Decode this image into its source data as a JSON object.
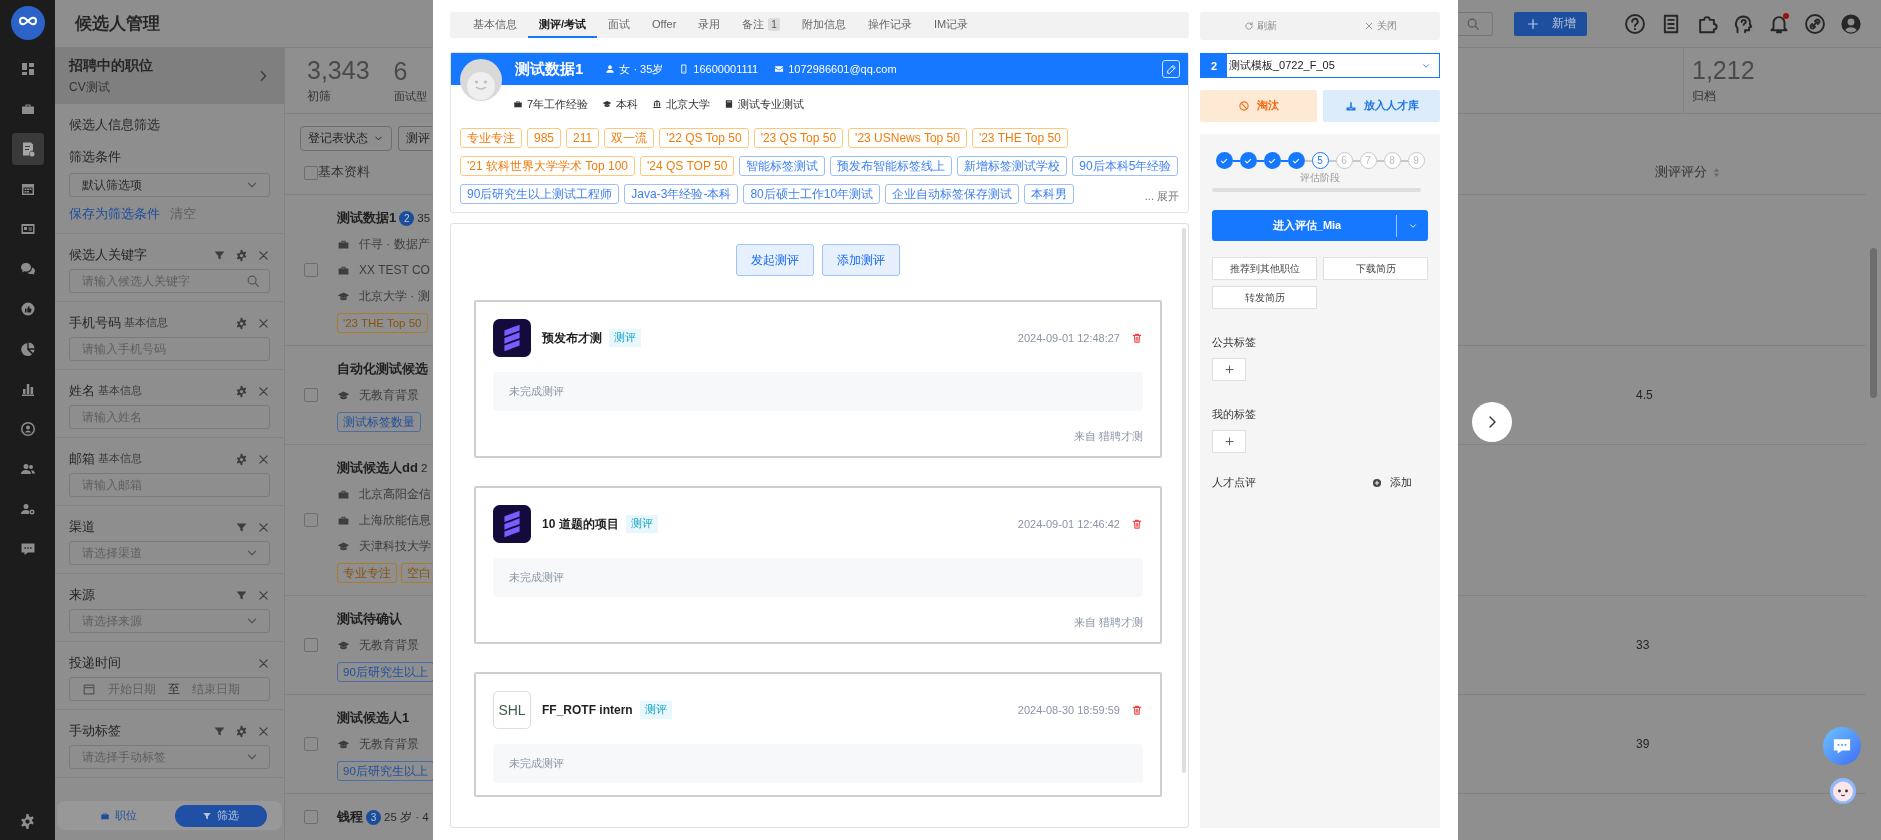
{
  "nav": {
    "items": [
      {
        "selected": false
      },
      {
        "selected": false
      },
      {
        "selected": true
      },
      {
        "selected": false
      },
      {
        "selected": false
      },
      {
        "selected": false
      },
      {
        "selected": false
      },
      {
        "selected": false
      },
      {
        "selected": false
      },
      {
        "selected": false
      },
      {
        "selected": false
      },
      {
        "selected": false
      },
      {
        "selected": false
      }
    ]
  },
  "header": {
    "title": "候选人管理",
    "new_button": "新增",
    "notification_dot": true
  },
  "job": {
    "title": "招聘中的职位",
    "subtitle": "CV测试"
  },
  "filters": {
    "heading": "候选人信息筛选",
    "preset_label": "筛选条件",
    "preset_value": "默认筛选项",
    "save_link": "保存为筛选条件",
    "clear_link": "清空",
    "fields": [
      {
        "label": "候选人关键字",
        "kind": "search",
        "placeholder": "请输入候选人关键字",
        "funnel": true,
        "settings": true
      },
      {
        "label": "手机号码",
        "note": "基本信息",
        "kind": "text",
        "placeholder": "请输入手机号码",
        "funnel": false,
        "settings": true
      },
      {
        "label": "姓名",
        "note": "基本信息",
        "kind": "text",
        "placeholder": "请输入姓名",
        "funnel": false,
        "settings": true
      },
      {
        "label": "邮箱",
        "note": "基本信息",
        "kind": "text",
        "placeholder": "请输入邮箱",
        "funnel": false,
        "settings": true
      },
      {
        "label": "渠道",
        "kind": "select",
        "placeholder": "请选择渠道",
        "funnel": true,
        "settings": false
      },
      {
        "label": "来源",
        "kind": "select",
        "placeholder": "请选择来源",
        "funnel": true,
        "settings": false
      },
      {
        "label": "投递时间",
        "kind": "date_range",
        "start_placeholder": "开始日期",
        "separator": "至",
        "end_placeholder": "结束日期",
        "funnel": false,
        "settings": false
      },
      {
        "label": "手动标签",
        "kind": "select",
        "placeholder": "请选择手动标签",
        "funnel": true,
        "settings": true
      }
    ]
  },
  "bottom_tabs": [
    {
      "label": "职位",
      "selected": false
    },
    {
      "label": "筛选",
      "selected": true
    }
  ],
  "stages": [
    {
      "count": "3,343",
      "label": "初筛"
    },
    {
      "count": "6",
      "label": "面试型"
    }
  ],
  "archive": {
    "count": "1,212",
    "label": "归档"
  },
  "toolbar": {
    "status_filter": "登记表状态",
    "assessment_filter": "测评"
  },
  "table": {
    "all_checked": false,
    "columns": [
      "基本资料",
      "测评评分"
    ],
    "rows": [
      {
        "checked": false,
        "name": "测试数据1",
        "badge": "2",
        "meta": "35",
        "lines": [
          {
            "kind": "work",
            "text": "仟寻 · 数据产"
          },
          {
            "kind": "work",
            "text": "XX TEST CO"
          },
          {
            "kind": "education",
            "text": "北京大学 · 测"
          }
        ],
        "tags": [
          {
            "text": "'23 THE Top 50",
            "kind": "school"
          }
        ]
      },
      {
        "checked": false,
        "name": "自动化测试候选",
        "lines": [
          {
            "kind": "education",
            "text": "无教育背景"
          }
        ],
        "tags": [
          {
            "text": "测试标签数量",
            "kind": "smart"
          }
        ],
        "score": "4.5"
      },
      {
        "checked": false,
        "name": "测试候选人dd",
        "meta": "2",
        "lines": [
          {
            "kind": "work",
            "text": "北京高阳金信"
          },
          {
            "kind": "work",
            "text": "上海欣能信息"
          },
          {
            "kind": "education",
            "text": "天津科技大学"
          }
        ],
        "tags": [
          {
            "text": "专业专注",
            "kind": "school"
          },
          {
            "text": "空白",
            "kind": "school"
          }
        ]
      },
      {
        "checked": false,
        "name": "测试待确认",
        "lines": [
          {
            "kind": "education",
            "text": "无教育背景"
          }
        ],
        "tags": [
          {
            "text": "90后研究生以上",
            "kind": "smart"
          }
        ],
        "score": "33"
      },
      {
        "checked": false,
        "name": "测试候选人1",
        "lines": [
          {
            "kind": "education",
            "text": "无教育背景"
          }
        ],
        "tags": [
          {
            "text": "90后研究生以上",
            "kind": "smart"
          }
        ],
        "score": "39"
      },
      {
        "checked": false,
        "name": "钱程",
        "badge": "3",
        "meta": "25 岁 · 4",
        "lines": [],
        "tags": []
      }
    ]
  },
  "drawer": {
    "tabs": [
      {
        "label": "基本信息",
        "selected": false
      },
      {
        "label": "测评/考试",
        "selected": true
      },
      {
        "label": "面试",
        "selected": false
      },
      {
        "label": "Offer",
        "selected": false
      },
      {
        "label": "录用",
        "selected": false
      },
      {
        "label": "备注",
        "count": "1",
        "selected": false
      },
      {
        "label": "附加信息",
        "selected": false
      },
      {
        "label": "操作记录",
        "selected": false
      },
      {
        "label": "IM记录",
        "selected": false
      }
    ],
    "profile": {
      "name": "测试数据1",
      "gender_age": "女 · 35岁",
      "phone": "16600001111",
      "email": "1072986601@qq.com",
      "facts": [
        {
          "kind": "work",
          "text": "7年工作经验"
        },
        {
          "kind": "education",
          "text": "本科"
        },
        {
          "kind": "school",
          "text": "北京大学"
        },
        {
          "kind": "major",
          "text": "测试专业测试"
        }
      ],
      "tags": [
        {
          "text": "专业专注",
          "kind": "school"
        },
        {
          "text": "985",
          "kind": "school"
        },
        {
          "text": "211",
          "kind": "school"
        },
        {
          "text": "双一流",
          "kind": "school"
        },
        {
          "text": "'22 QS Top 50",
          "kind": "school"
        },
        {
          "text": "'23 QS Top 50",
          "kind": "school"
        },
        {
          "text": "'23 USNews Top 50",
          "kind": "school"
        },
        {
          "text": "'23 THE Top 50",
          "kind": "school"
        },
        {
          "text": "'21 软科世界大学学术 Top 100",
          "kind": "school"
        },
        {
          "text": "'24 QS TOP 50",
          "kind": "school"
        },
        {
          "text": "智能标签测试",
          "kind": "smart"
        },
        {
          "text": "预发布智能标签线上",
          "kind": "smart"
        },
        {
          "text": "新增标签测试学校",
          "kind": "smart"
        },
        {
          "text": "90后本科5年经验",
          "kind": "smart"
        },
        {
          "text": "90后研究生以上测试工程师",
          "kind": "smart"
        },
        {
          "text": "Java-3年经验-本科",
          "kind": "smart"
        },
        {
          "text": "80后硕士工作10年测试",
          "kind": "smart"
        },
        {
          "text": "企业自动标签保存测试",
          "kind": "smart"
        },
        {
          "text": "本科男",
          "kind": "smart"
        }
      ],
      "expand": "... 展开"
    },
    "assessments": {
      "buttons": [
        "发起测评",
        "添加测评"
      ],
      "items": [
        {
          "kind": "striped",
          "title": "预发布才测",
          "badge": "测评",
          "time": "2024-09-01 12:48:27",
          "status": "未完成测评",
          "source": "来自 猎聘才测"
        },
        {
          "kind": "striped",
          "title": "10 道题的项目",
          "badge": "测评",
          "time": "2024-09-01 12:46:42",
          "status": "未完成测评",
          "source": "来自 猎聘才测"
        },
        {
          "kind": "lettered",
          "logo_text": "SHL",
          "title": "FF_ROTF intern",
          "badge": "测评",
          "time": "2024-08-30 18:59:59",
          "status": "未完成测评"
        }
      ]
    }
  },
  "side": {
    "refresh": "刷新",
    "close": "关闭",
    "template": {
      "number": "2",
      "value": "测试模板_0722_F_05"
    },
    "reject": "淘汰",
    "pool": "放入人才库",
    "steps": [
      {
        "done": true
      },
      {
        "done": true
      },
      {
        "done": true
      },
      {
        "done": true
      },
      {
        "number": "5",
        "done": false,
        "current": true
      },
      {
        "number": "6",
        "done": false,
        "current": false
      },
      {
        "number": "7",
        "done": false,
        "current": false
      },
      {
        "number": "8",
        "done": false,
        "current": false
      },
      {
        "number": "9",
        "done": false,
        "current": false
      }
    ],
    "stage_label": "评估阶段",
    "advance": "进入评估_Mia",
    "actions": [
      "推荐到其他职位",
      "下载简历",
      "转发简历"
    ],
    "public_tags": "公共标签",
    "my_tags": "我的标签",
    "review": {
      "label": "人才点评",
      "add": "添加"
    }
  }
}
